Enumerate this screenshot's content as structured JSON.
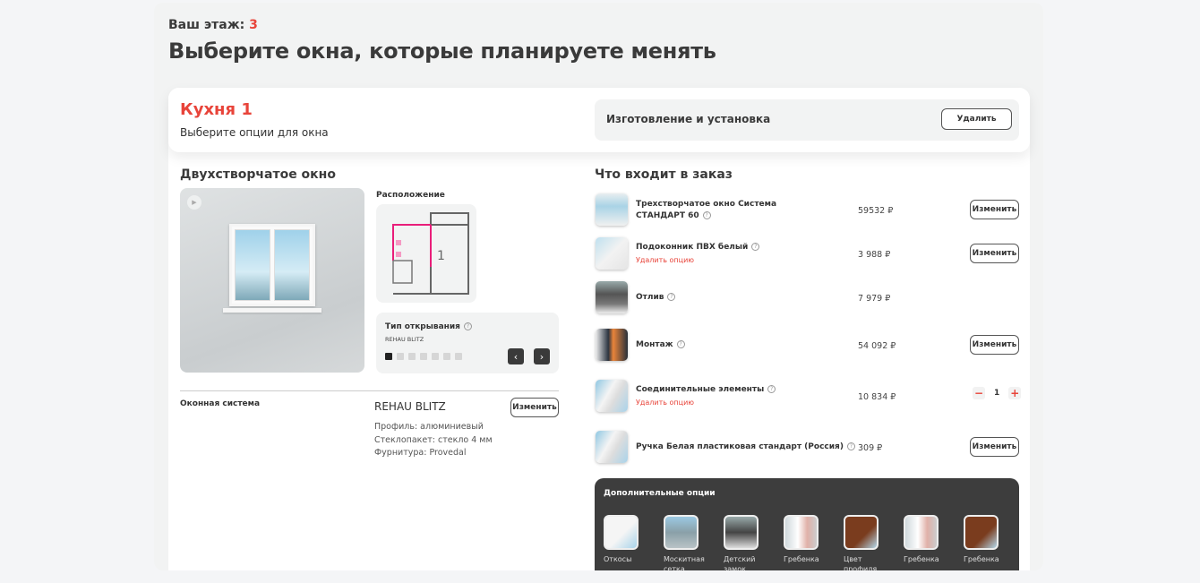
{
  "floor": {
    "label": "Ваш этаж:",
    "value": "3"
  },
  "title": "Выберите окна, которые планируете менять",
  "room": {
    "name": "Кухня 1",
    "subtitle": "Выберите опции для окна"
  },
  "service": {
    "label": "Изготовление и установка",
    "delete_button": "Удалить"
  },
  "left": {
    "window_title": "Двухстворчатое окно",
    "location_label": "Расположение",
    "plan_room_number": "1",
    "opening": {
      "label": "Тип открывания",
      "value": "REHAU BLITZ",
      "total_steps": 7,
      "current_step": 1
    },
    "system_label": "Оконная система",
    "system_name": "REHAU BLITZ",
    "change_button": "Изменить",
    "specs": [
      "Профиль: алюминиевый",
      "Стеклопакет: стекло 4 мм",
      "Фурнитура: Provedal"
    ]
  },
  "order": {
    "title": "Что входит в заказ",
    "delete_option": "Удалить опцию",
    "change_button": "Изменить",
    "items": [
      {
        "name": "Трехстворчатое окно Система СТАНДАРТ 60",
        "price": "59532 ₽"
      },
      {
        "name": "Подоконник ПВХ белый",
        "price": "3 988 ₽"
      },
      {
        "name": "Отлив",
        "price": "7 979 ₽"
      },
      {
        "name": "Монтаж",
        "price": "54 092 ₽"
      },
      {
        "name": "Соединительные элементы",
        "price": "10 834 ₽",
        "quantity": "1"
      },
      {
        "name": "Ручка Белая пластиковая стандарт (Россия)",
        "price": "309 ₽"
      }
    ]
  },
  "extra": {
    "title": "Дополнительные опции",
    "options": [
      "Откосы",
      "Москитная сетка",
      "Детский замок",
      "Гребенка",
      "Цвет профиля",
      "Гребенка",
      "Гребенка"
    ]
  },
  "colors": {
    "accent": "#e8443a",
    "dark": "#3d3d3d"
  }
}
